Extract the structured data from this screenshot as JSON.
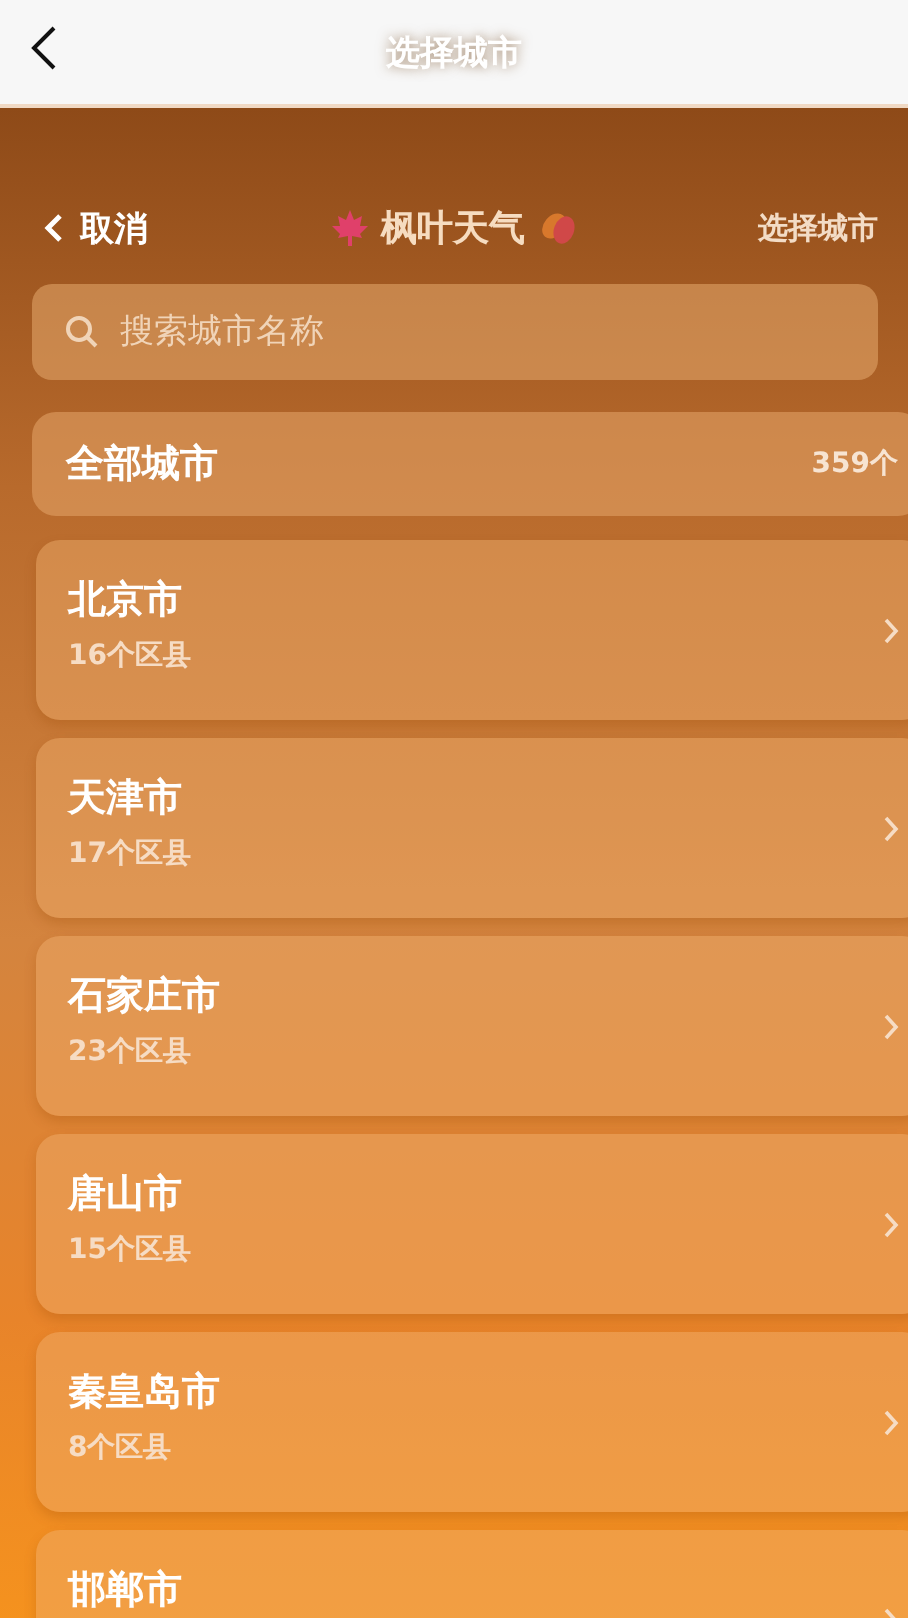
{
  "nav_bar": {
    "title": "选择城市"
  },
  "header": {
    "cancel": "取消",
    "app_name": "枫叶天气",
    "right_label": "选择城市"
  },
  "search": {
    "placeholder": "搜索城市名称"
  },
  "all_cities": {
    "label": "全部城市",
    "count": "359个"
  },
  "cities": [
    {
      "name": "北京市",
      "districts": "16个区县"
    },
    {
      "name": "天津市",
      "districts": "17个区县"
    },
    {
      "name": "石家庄市",
      "districts": "23个区县"
    },
    {
      "name": "唐山市",
      "districts": "15个区县"
    },
    {
      "name": "秦皇岛市",
      "districts": "8个区县"
    },
    {
      "name": "邯郸市"
    }
  ]
}
